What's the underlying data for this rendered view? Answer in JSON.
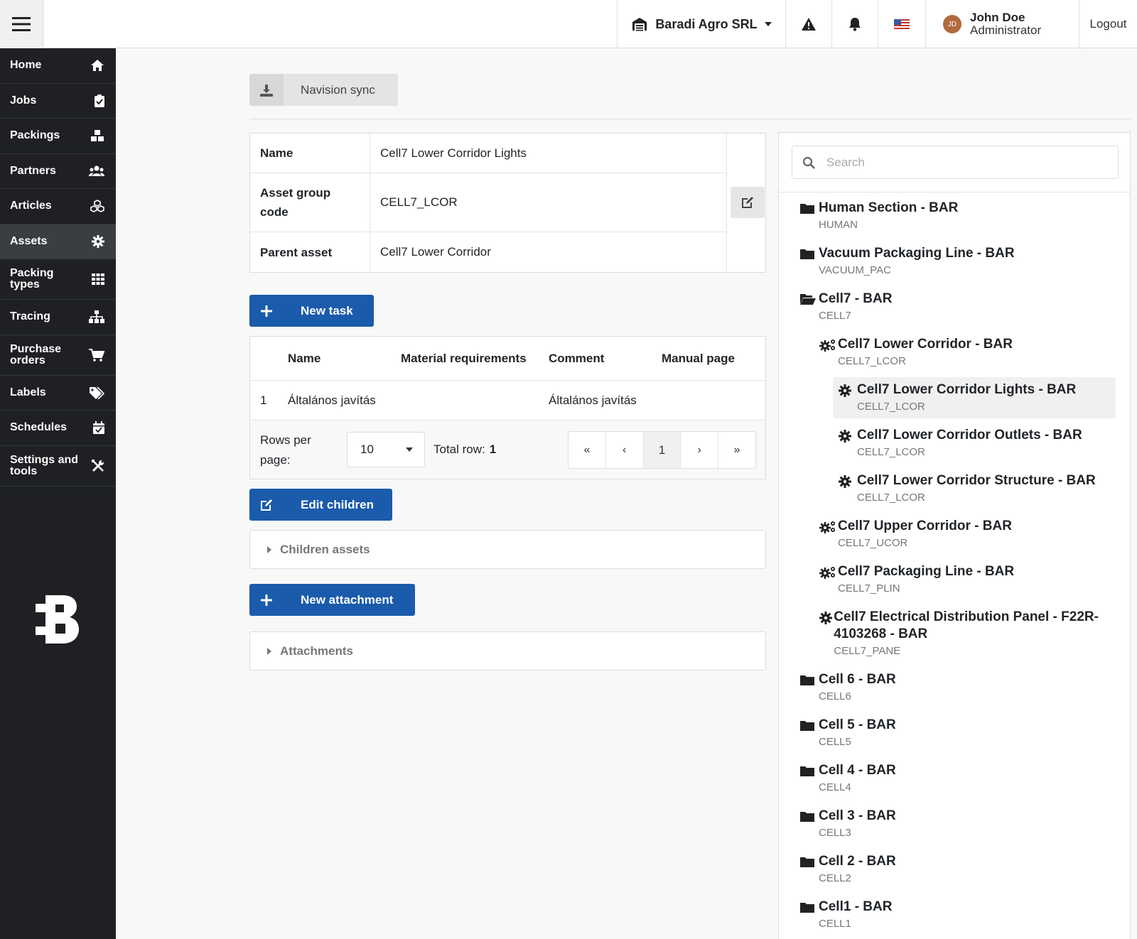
{
  "topbar": {
    "company": "Baradi Agro SRL",
    "user_initials": "JD",
    "user_name": "John Doe",
    "user_role": "Administrator",
    "logout": "Logout"
  },
  "sidebar": {
    "items": [
      {
        "label": "Home",
        "icon": "home-icon"
      },
      {
        "label": "Jobs",
        "icon": "clipboard-icon"
      },
      {
        "label": "Packings",
        "icon": "boxes-icon"
      },
      {
        "label": "Partners",
        "icon": "users-icon"
      },
      {
        "label": "Articles",
        "icon": "cubes-icon"
      },
      {
        "label": "Assets",
        "icon": "gear-icon",
        "active": true
      },
      {
        "label": "Packing types",
        "icon": "grid-icon"
      },
      {
        "label": "Tracing",
        "icon": "sitemap-icon"
      },
      {
        "label": "Purchase orders",
        "icon": "cart-icon"
      },
      {
        "label": "Labels",
        "icon": "tags-icon"
      },
      {
        "label": "Schedules",
        "icon": "calendar-icon"
      },
      {
        "label": "Settings and tools",
        "icon": "tools-icon"
      }
    ],
    "logo": "B"
  },
  "main": {
    "sync_button": "Navision sync",
    "info": {
      "name_label": "Name",
      "name_value": "Cell7 Lower Corridor Lights",
      "code_label": "Asset group code",
      "code_value": "CELL7_LCOR",
      "parent_label": "Parent asset",
      "parent_value": "Cell7 Lower Corridor"
    },
    "new_task_button": "New task",
    "tasks_table": {
      "columns": [
        "Name",
        "Material requirements",
        "Comment",
        "Manual page"
      ],
      "rows": [
        {
          "index": "1",
          "name": "Általános javítás",
          "material": "",
          "comment": "Általános javítás",
          "manual": ""
        }
      ],
      "rows_per_page_label": "Rows per page:",
      "rows_per_page_value": "10",
      "total_label": "Total row:",
      "total_value": "1",
      "pager": {
        "first": "«",
        "prev": "‹",
        "current": "1",
        "next": "›",
        "last": "»"
      }
    },
    "edit_children_button": "Edit children",
    "children_assets": "Children assets",
    "new_attachment_button": "New attachment",
    "attachments": "Attachments"
  },
  "tree": {
    "search_placeholder": "Search",
    "nodes": [
      {
        "name": "Human Section - BAR",
        "code": "HUMAN",
        "icon": "folder-icon",
        "level": 0
      },
      {
        "name": "Vacuum Packaging Line - BAR",
        "code": "VACUUM_PAC",
        "icon": "folder-icon",
        "level": 0
      },
      {
        "name": "Cell7 - BAR",
        "code": "CELL7",
        "icon": "folder-open-icon",
        "level": 0
      },
      {
        "name": "Cell7 Lower Corridor - BAR",
        "code": "CELL7_LCOR",
        "icon": "gears-icon",
        "level": 1
      },
      {
        "name": "Cell7 Lower Corridor Lights - BAR",
        "code": "CELL7_LCOR",
        "icon": "gear-icon",
        "level": 2,
        "selected": true
      },
      {
        "name": "Cell7 Lower Corridor Outlets - BAR",
        "code": "CELL7_LCOR",
        "icon": "gear-icon",
        "level": 2
      },
      {
        "name": "Cell7 Lower Corridor Structure - BAR",
        "code": "CELL7_LCOR",
        "icon": "gear-icon",
        "level": 2
      },
      {
        "name": "Cell7 Upper Corridor - BAR",
        "code": "CELL7_UCOR",
        "icon": "gears-icon",
        "level": 1
      },
      {
        "name": "Cell7 Packaging Line - BAR",
        "code": "CELL7_PLIN",
        "icon": "gears-icon",
        "level": 1
      },
      {
        "name": "Cell7 Electrical Distribution Panel - F22R-4103268 - BAR",
        "code": "CELL7_PANE",
        "icon": "gear-icon",
        "level": 1
      },
      {
        "name": "Cell 6 - BAR",
        "code": "CELL6",
        "icon": "folder-icon",
        "level": 0
      },
      {
        "name": "Cell 5 - BAR",
        "code": "CELL5",
        "icon": "folder-icon",
        "level": 0
      },
      {
        "name": "Cell 4 - BAR",
        "code": "CELL4",
        "icon": "folder-icon",
        "level": 0
      },
      {
        "name": "Cell 3 - BAR",
        "code": "CELL3",
        "icon": "folder-icon",
        "level": 0
      },
      {
        "name": "Cell 2 - BAR",
        "code": "CELL2",
        "icon": "folder-icon",
        "level": 0
      },
      {
        "name": "Cell1 - BAR",
        "code": "CELL1",
        "icon": "folder-icon",
        "level": 0
      }
    ]
  },
  "colors": {
    "sidebar_bg": "#1e2023",
    "primary": "#1a5bab",
    "avatar": "#b06a3c"
  }
}
